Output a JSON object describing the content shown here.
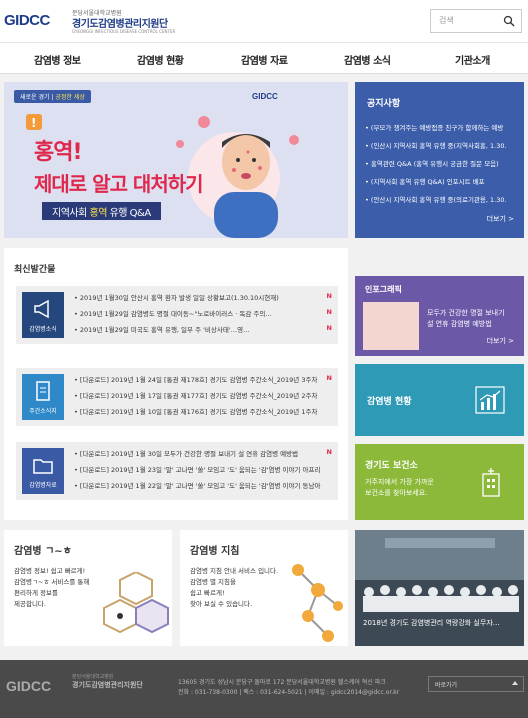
{
  "header": {
    "logo_mark": "GIDCC",
    "logo_sub": "분당서울대학교병원",
    "logo_title": "경기도감염병관리지원단",
    "logo_en": "GYEONGGI INFECTIOUS DISEASE CONTROL CENTER",
    "search_placeholder": "검색"
  },
  "nav": [
    "감염병 정보",
    "감염병 현황",
    "감염병 자료",
    "감염병 소식",
    "기관소개"
  ],
  "hero": {
    "tag_a": "새로운 경기",
    "tag_b": "공정한 세상",
    "logo": "GIDCC",
    "line1": "홍역!",
    "line2": "제대로 알고 대처하기",
    "band_a": "지역사회",
    "band_b": "홍역",
    "band_c": "유행 Q&A",
    "slides_total": 2,
    "slide_active": 1
  },
  "notice": {
    "title": "공지사항",
    "items": [
      "(부모가 챙겨주는 예방접종 친구가 함께하는 예방",
      "(인산시 지역사회 홍역 유행 중(지역사회홍, 1.30.",
      "홍역관련 Q&A (홍역 유행시 궁금한 질문 모음)",
      "(지역사회 홍역 유행 Q&A) 인포시트 배포",
      "(안산시 지역사회 홍역 유행 중(의료기관용, 1.30."
    ],
    "more": "더보기 >"
  },
  "recent": {
    "title": "최신발간물",
    "groups": [
      {
        "badge": "감염병소식",
        "items": [
          {
            "text": "2019년 1월30일 안산시 홍역 환자 발생 일일 상황보고(1.30.10시현재)",
            "new": "N"
          },
          {
            "text": "2019년 1월29일 감염병도 명절 대이동~\"노로바이러스 · 독감 주의…",
            "new": "N"
          },
          {
            "text": "2019년 1월29일 미국도 홍역 유행, 일부 주 '비상사태'…영…",
            "new": "N"
          }
        ]
      },
      {
        "badge": "주간소식지",
        "items": [
          {
            "text": "[다운로드] 2019년 1월 24일 [통권 제178호] 경기도 감염병 주간소식_2019년 3주차",
            "new": "N"
          },
          {
            "text": "[다운로드] 2019년 1월 17일 [통권 제177호] 경기도 감염병 주간소식_2019년 2주차",
            "new": ""
          },
          {
            "text": "[다운로드] 2019년 1월 10일 [통권 제176호] 경기도 감염병 주간소식_2019년 1주차",
            "new": ""
          }
        ]
      },
      {
        "badge": "감염병자료",
        "items": [
          {
            "text": "[다운로드] 2019년 1월 30일 모두가 건강한 명절 보내기 설 연휴 감염병 예방법",
            "new": "N"
          },
          {
            "text": "[다운로드] 2019년 1월 23일 '말' 고나면 '쏠' 모임고 '도' 움되는 '감'염병 이야기 아프리",
            "new": ""
          },
          {
            "text": "[다운로드] 2019년 1월 22일 '말' 고나면 '쏠' 모임고 '도' 움되는 '감'염병 이야기 동남아",
            "new": ""
          }
        ]
      }
    ]
  },
  "infographic": {
    "title": "인포그래픽",
    "desc_1": "모두가 건강한 명절 보내기",
    "desc_2": "설 연휴 감염병 예방법",
    "more": "더보기 >"
  },
  "status_tile": {
    "title": "감염병 현황"
  },
  "gg_tile": {
    "title": "경기도 보건소",
    "desc_1": "거주지에서 가장 가까운",
    "desc_2": "보건소를 찾아보세요."
  },
  "az_card": {
    "title": "감염병 ㄱ~ㅎ",
    "desc": [
      "감염병 정보! 쉽고 빠르게!",
      "감염병ㄱ~ㅎ 서비스를 통해",
      "편리하게 정보를",
      "제공합니다."
    ]
  },
  "guide_card": {
    "title": "감염병 지침",
    "desc": [
      "감염병 지침 안내 서비스 입니다.",
      "감염병 별 지침을",
      "쉽고 빠르게!",
      "찾아 보실 수 있습니다."
    ]
  },
  "photo": {
    "caption": "2018년 경기도 감염병관리 역량강화 실무자…"
  },
  "footer": {
    "logo": "GIDCC",
    "sub": "분당서울대학교병원",
    "title": "경기도감염병관리지원단",
    "addr_1": "13605 경기도 성남시 분당구 돌마로 172 분당서울대학교병원 헬스케어 혁신 파크",
    "addr_2": "전화 : 031-738-0300 | 팩스 : 031-624-5021 | 이메일 : gidcc2014@gidcc.or.kr",
    "link_label": "바로가기"
  },
  "colors": {
    "brand": "#1f3c88",
    "notice": "#3c5eaa",
    "infographic": "#6b59a8",
    "status": "#2f9ab5",
    "health_center": "#8cb93a",
    "alert": "#e0284c"
  }
}
